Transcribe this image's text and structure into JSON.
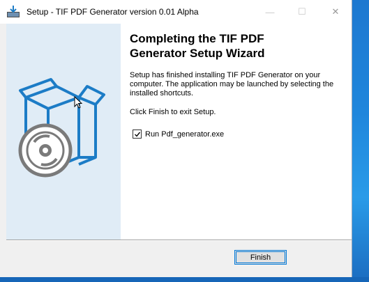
{
  "window": {
    "title": "Setup - TIF PDF Generator version 0.01 Alpha",
    "controls": {
      "minimize": "—",
      "maximize": "☐",
      "close": "✕"
    }
  },
  "wizard": {
    "heading": "Completing the TIF PDF\nGenerator Setup Wizard",
    "body": "Setup has finished installing TIF PDF Generator on your computer. The application may be launched by selecting the installed shortcuts.",
    "finish_prompt": "Click Finish to exit Setup.",
    "run_checkbox": {
      "label": "Run Pdf_generator.exe",
      "checked": true
    }
  },
  "buttons": {
    "finish": "Finish"
  },
  "icons": [
    "installer-app-icon",
    "box-disc-icon",
    "mouse-cursor-icon"
  ],
  "colors": {
    "accent": "#0078d7",
    "banner": "#e0ecf6",
    "box_stroke": "#1c7cc6",
    "disc": "#7a7a7a"
  }
}
